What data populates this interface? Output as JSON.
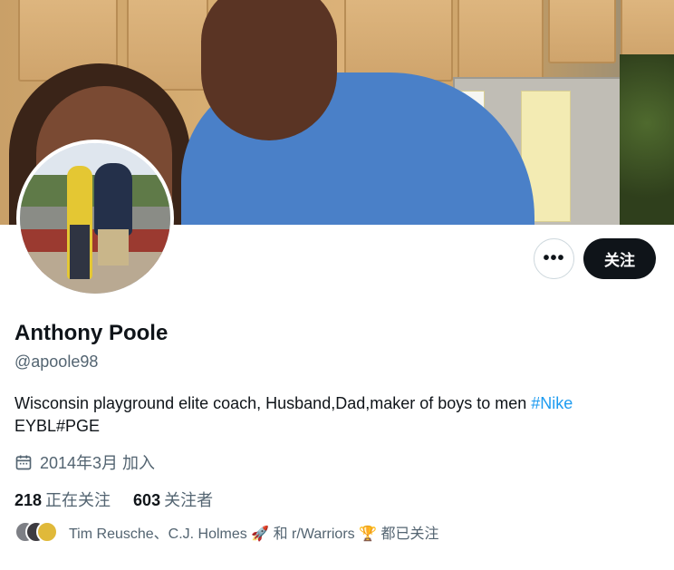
{
  "profile": {
    "name": "Anthony Poole",
    "handle": "@apoole98",
    "bio_text": "Wisconsin playground elite coach, Husband,Dad,maker of boys to men ",
    "bio_hashtag": "#Nike",
    "bio_line2": "EYBL#PGE",
    "joined": "2014年3月 加入",
    "following_count": "218",
    "following_label": "正在关注",
    "followers_count": "603",
    "followers_label": "关注者",
    "followed_by": "Tim Reusche、C.J. Holmes 🚀 和 r/Warriors 🏆 都已关注"
  },
  "actions": {
    "more_label": "•••",
    "follow_label": "关注"
  },
  "icons": {
    "joined": "calendar-icon",
    "more": "more-icon"
  },
  "colors": {
    "accent": "#1d9bf0",
    "primary_text": "#0f1419",
    "secondary_text": "#536471",
    "follow_button_bg": "#0f1419"
  }
}
